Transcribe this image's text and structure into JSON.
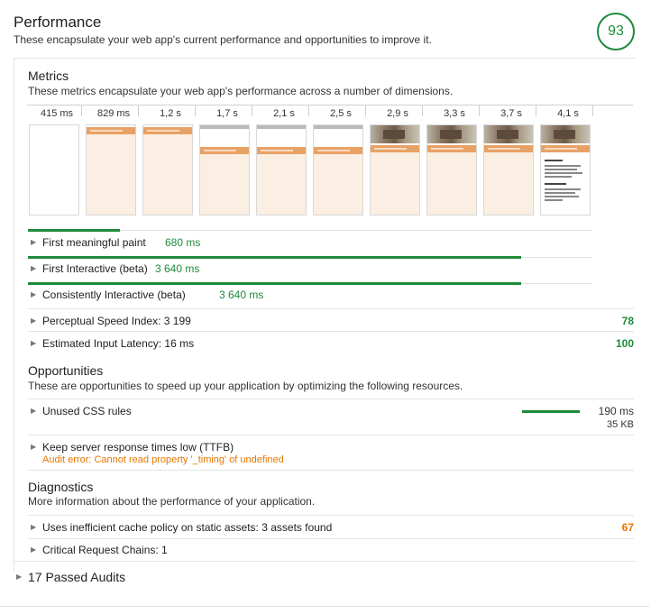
{
  "header": {
    "title": "Performance",
    "description": "These encapsulate your web app's current performance and opportunities to improve it.",
    "score": "93"
  },
  "metrics": {
    "title": "Metrics",
    "description": "These metrics encapsulate your web app's performance across a number of dimensions.",
    "filmstrip_times": [
      "415 ms",
      "829 ms",
      "1,2 s",
      "1,7 s",
      "2,1 s",
      "2,5 s",
      "2,9 s",
      "3,3 s",
      "3,7 s",
      "4,1 s"
    ],
    "items": [
      {
        "label": "First meaningful paint",
        "value": "680 ms",
        "bar_fraction": 0.187
      },
      {
        "label": "First Interactive (beta)",
        "value": "3 640 ms",
        "bar_fraction": 1.0
      },
      {
        "label": "Consistently Interactive (beta)",
        "value": "3 640 ms",
        "bar_fraction": 1.0
      },
      {
        "label": "Perceptual Speed Index: 3 199",
        "score": "78"
      },
      {
        "label": "Estimated Input Latency: 16 ms",
        "score": "100"
      }
    ]
  },
  "opportunities": {
    "title": "Opportunities",
    "description": "These are opportunities to speed up your application by optimizing the following resources.",
    "items": [
      {
        "label": "Unused CSS rules",
        "time": "190 ms",
        "size": "35 KB"
      },
      {
        "label": "Keep server response times low (TTFB)",
        "error": "Audit error: Cannot read property '_timing' of undefined"
      }
    ]
  },
  "diagnostics": {
    "title": "Diagnostics",
    "description": "More information about the performance of your application.",
    "items": [
      {
        "label": "Uses inefficient cache policy on static assets: 3 assets found",
        "score": "67"
      },
      {
        "label": "Critical Request Chains: 1"
      }
    ]
  },
  "passed": {
    "label": "17 Passed Audits"
  },
  "colors": {
    "pass": "#1e8a3a",
    "average": "#e67700"
  }
}
